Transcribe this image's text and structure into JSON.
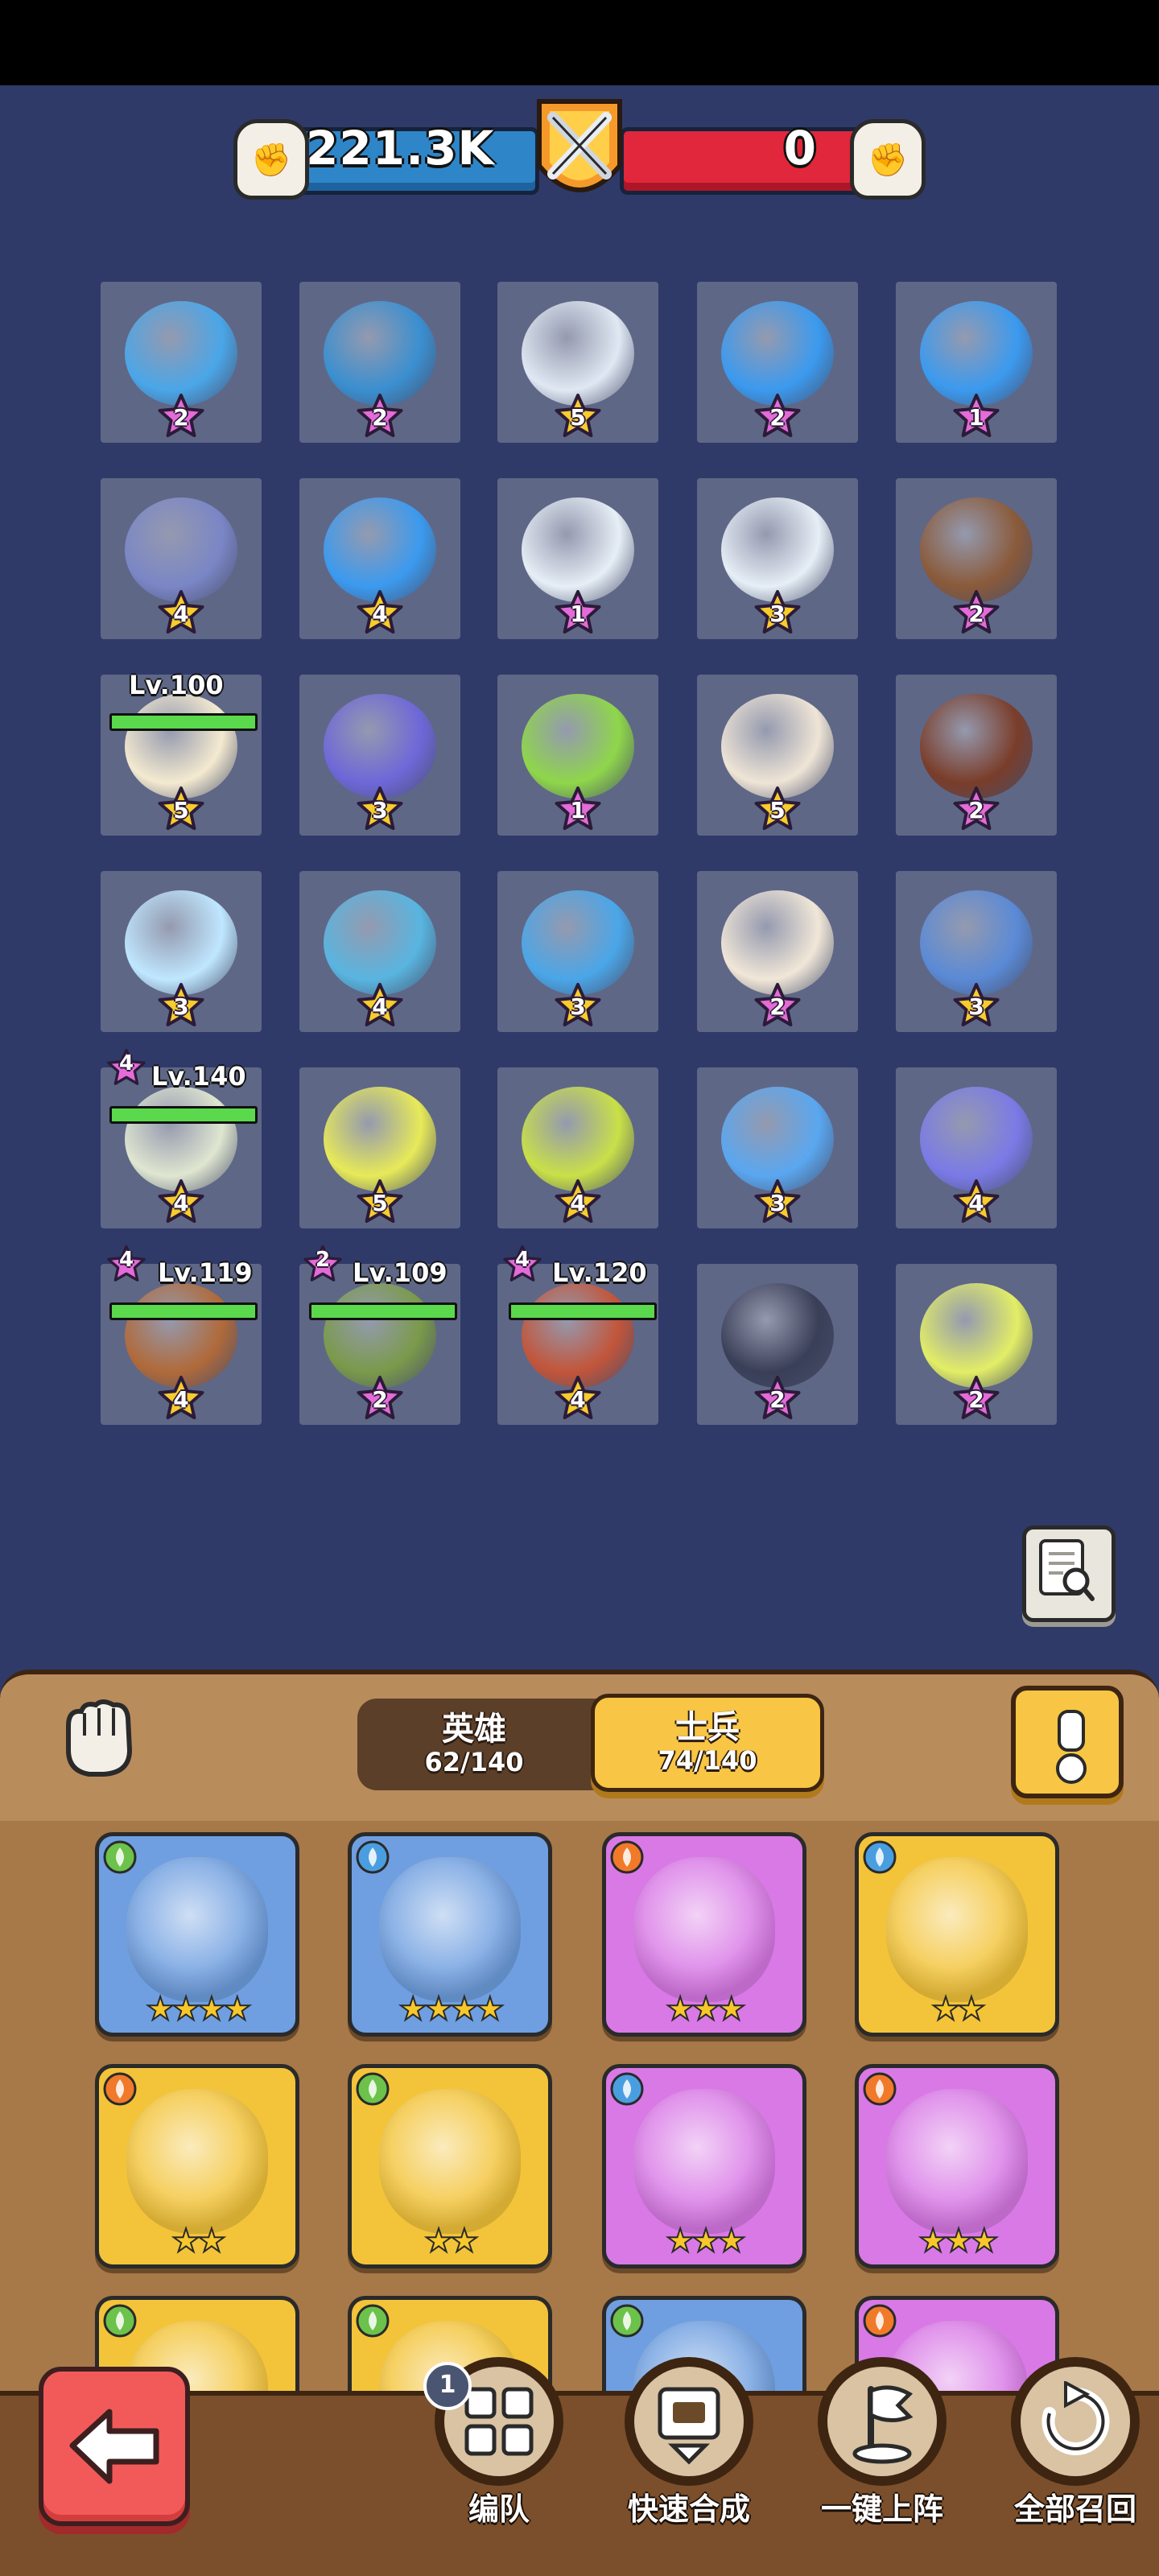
{
  "power": {
    "player": "221.3K",
    "enemy": "0"
  },
  "grid": {
    "stars": [
      [
        "2",
        "2",
        "5",
        "2",
        "1"
      ],
      [
        "4",
        "4",
        "1",
        "3",
        "2"
      ],
      [
        "5",
        "3",
        "1",
        "5",
        "2"
      ],
      [
        "3",
        "4",
        "3",
        "2",
        "3"
      ],
      [
        "4",
        "5",
        "4",
        "3",
        "4"
      ],
      [
        "4",
        "2",
        "4",
        "2",
        "2"
      ]
    ]
  },
  "heroes_on_field": [
    {
      "level": "Lv.100"
    },
    {
      "level": "Lv.140",
      "badge": "4"
    },
    {
      "level": "Lv.119",
      "badge": "4"
    },
    {
      "level": "Lv.109",
      "badge": "2"
    },
    {
      "level": "Lv.120",
      "badge": "4"
    }
  ],
  "tabs": {
    "heroes_label": "英雄",
    "heroes_count": "62/140",
    "soldiers_label": "士兵",
    "soldiers_count": "74/140"
  },
  "cards": [
    {
      "stars": "★★★★",
      "element": "leaf",
      "bg": "#6f9fe0"
    },
    {
      "stars": "★★★★",
      "element": "water",
      "bg": "#6f9fe0"
    },
    {
      "stars": "★★★",
      "element": "fire",
      "bg": "#d979e6"
    },
    {
      "stars": "★★",
      "element": "water",
      "bg": "#f3c43a"
    },
    {
      "stars": "★★",
      "element": "fire",
      "bg": "#f3c43a"
    },
    {
      "stars": "★★",
      "element": "leaf",
      "bg": "#f3c43a"
    },
    {
      "stars": "★★★",
      "element": "water",
      "bg": "#d979e6"
    },
    {
      "stars": "★★★",
      "element": "fire",
      "bg": "#d979e6"
    },
    {
      "stars": "",
      "element": "leaf",
      "bg": "#f3c43a"
    },
    {
      "stars": "",
      "element": "leaf",
      "bg": "#f3c43a"
    },
    {
      "stars": "",
      "element": "leaf",
      "bg": "#6f9fe0"
    },
    {
      "stars": "",
      "element": "fire",
      "bg": "#d979e6"
    }
  ],
  "nav": {
    "formation": "编队",
    "formation_badge": "1",
    "quick_merge": "快速合成",
    "one_click_deploy": "一键上阵",
    "recall_all": "全部召回"
  }
}
